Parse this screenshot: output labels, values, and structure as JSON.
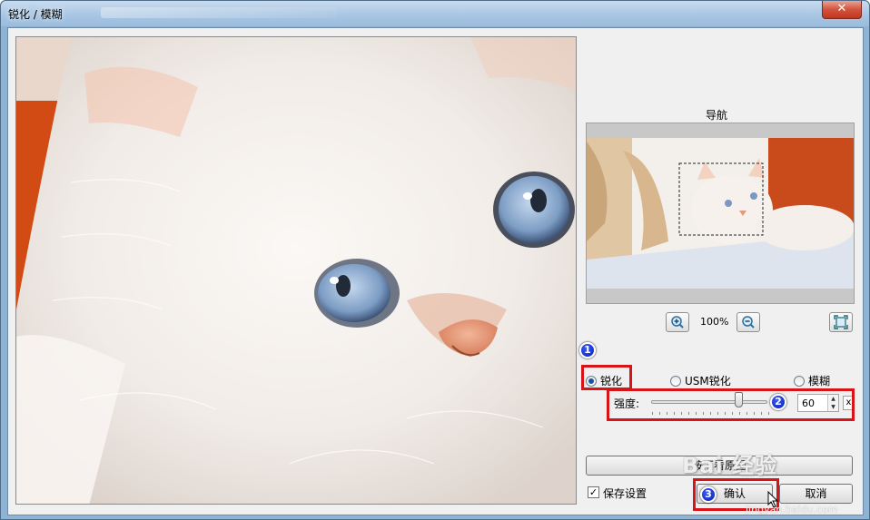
{
  "window": {
    "title": "锐化 / 模糊",
    "close_glyph": "✕"
  },
  "navigator": {
    "label": "导航",
    "zoom_level": "100%"
  },
  "modes": {
    "sharpen": "锐化",
    "usm": "USM锐化",
    "blur": "模糊",
    "selected": "sharpen"
  },
  "strength": {
    "label": "强度:",
    "value": "60",
    "reset_label": "x"
  },
  "buttons": {
    "compare": "按下看原图",
    "ok": "确认",
    "cancel": "取消"
  },
  "save_settings": {
    "label": "保存设置",
    "checked": true,
    "check_glyph": "✓"
  },
  "annotations": {
    "step1": "1",
    "step2": "2",
    "step3": "3"
  },
  "watermark": {
    "text": "Bai 经验",
    "sub": "jingyan.baidu.com"
  },
  "colors": {
    "accent_red": "#d81418",
    "marker_blue": "#0a1fb0",
    "background_orange": "#d24a14"
  },
  "icons": {
    "zoom_in": "zoom-in-icon",
    "zoom_out": "zoom-out-icon",
    "fit": "fit-screen-icon",
    "spin": "spin-arrows-icon"
  }
}
